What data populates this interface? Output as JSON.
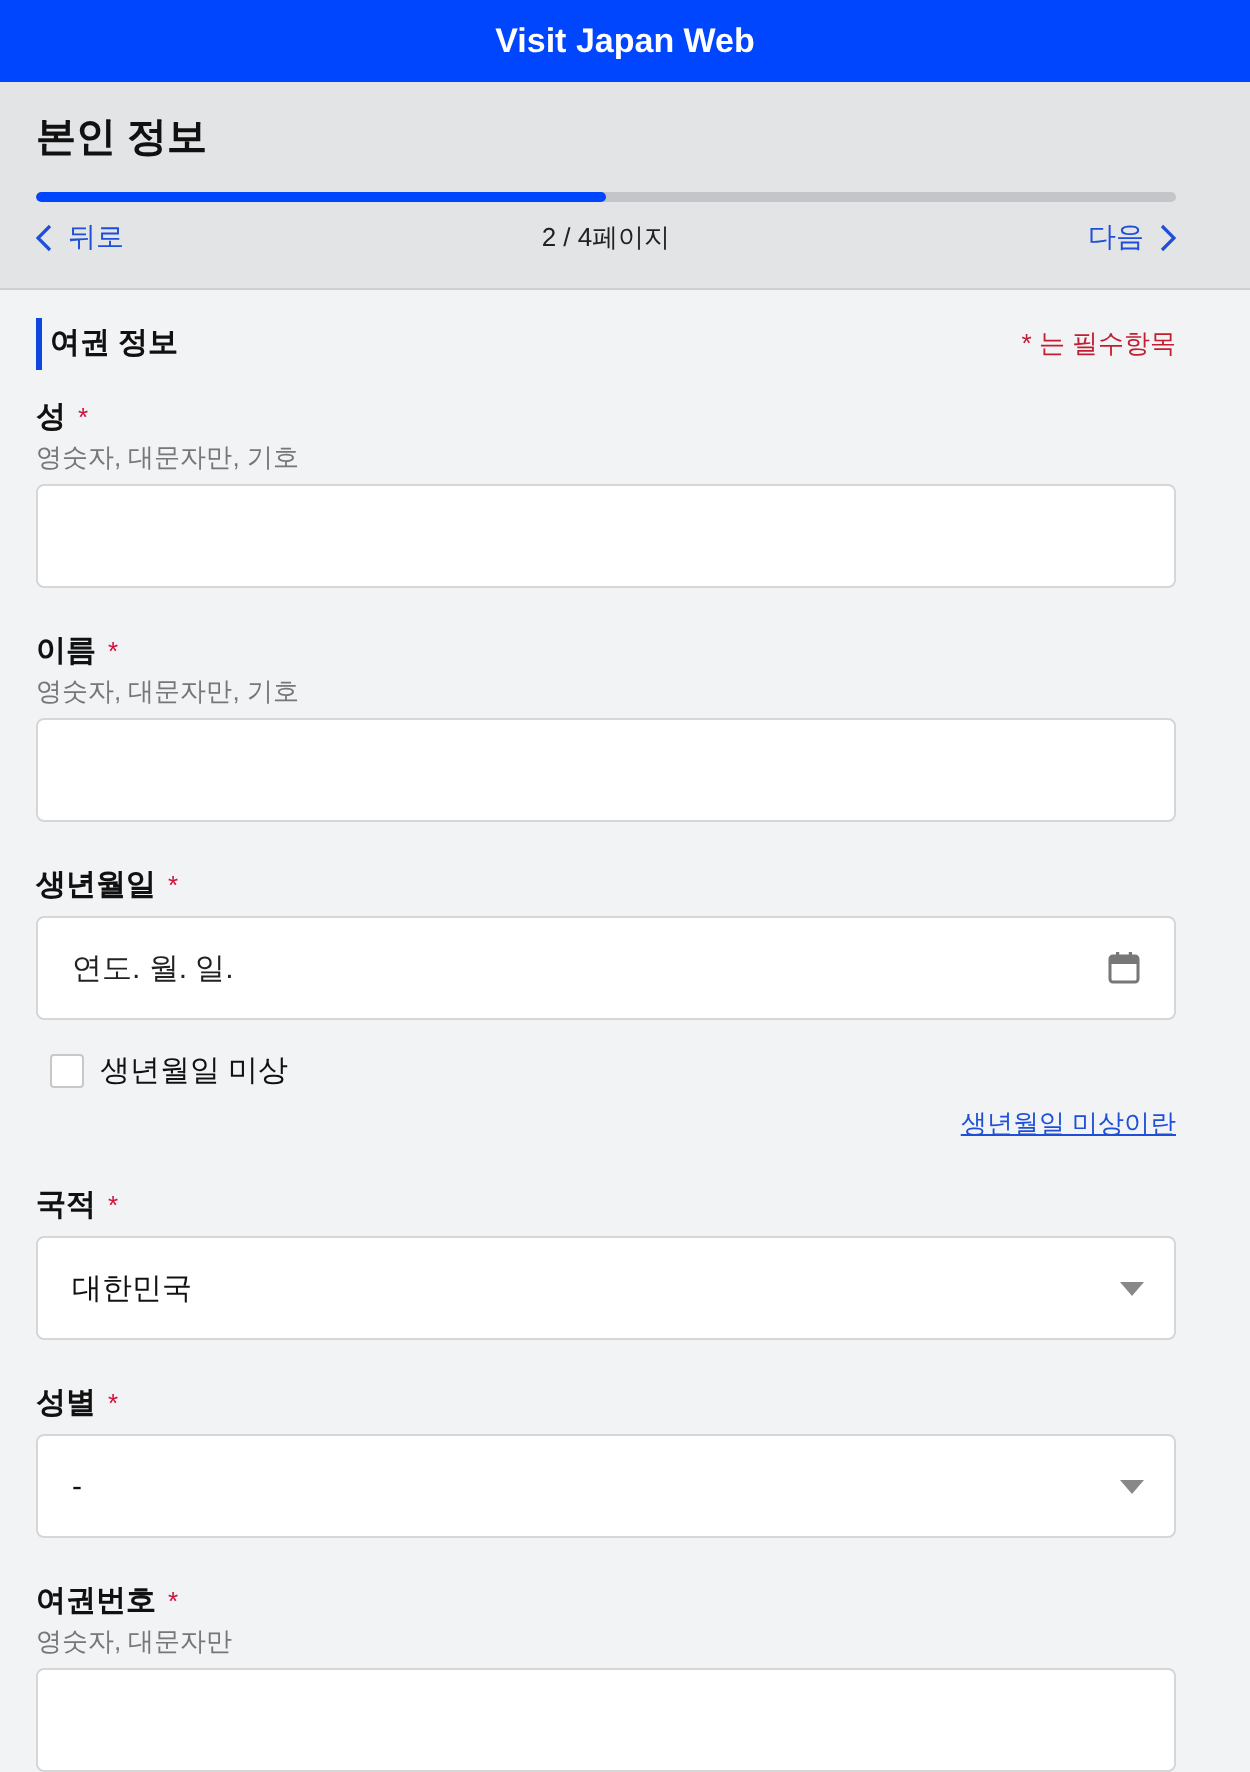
{
  "header": {
    "title": "Visit Japan Web"
  },
  "page": {
    "title": "본인 정보",
    "progress": {
      "level": 0.5
    },
    "back": {
      "label": "뒤로"
    },
    "page_indicator": "2 / 4페이지",
    "next": {
      "label": "다음"
    }
  },
  "section": {
    "title": "여권 정보",
    "required_legend": "* 는 필수항목"
  },
  "fields": [
    {
      "kind": "text",
      "label": "성",
      "required_mark": "*",
      "hint": "영숫자, 대문자만, 기호"
    },
    {
      "kind": "text",
      "label": "이름",
      "required_mark": "*",
      "hint": "영숫자, 대문자만, 기호"
    },
    {
      "kind": "date",
      "label": "생년월일",
      "required_mark": "*",
      "placeholder": "연도. 월. 일.",
      "checkbox": {
        "label": "생년월일 미상",
        "checked": false
      },
      "link": "생년월일 미상이란"
    },
    {
      "kind": "select",
      "label": "국적",
      "required_mark": "*",
      "value": "대한민국"
    },
    {
      "kind": "select",
      "label": "성별",
      "required_mark": "*",
      "value": "-"
    },
    {
      "kind": "text",
      "label": "여권번호",
      "required_mark": "*",
      "hint": "영숫자, 대문자만"
    }
  ]
}
